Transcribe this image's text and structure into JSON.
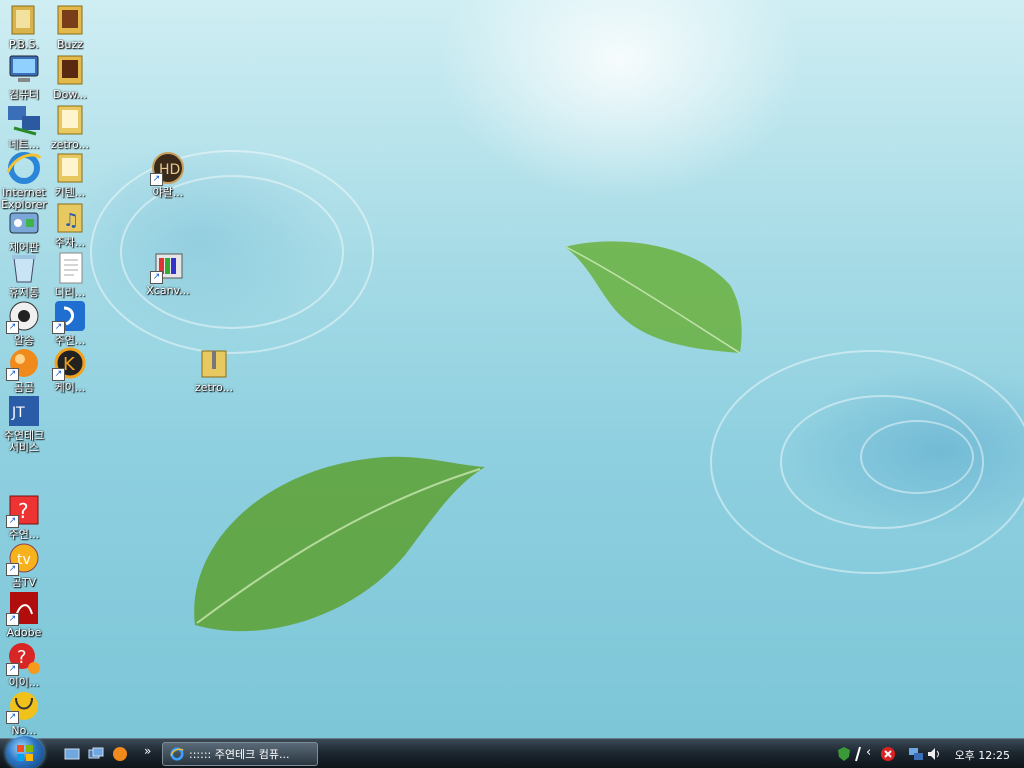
{
  "desktop": {
    "icons": [
      {
        "label": "P.B.S."
      },
      {
        "label": "Buzz"
      },
      {
        "label": "컴퓨터"
      },
      {
        "label": "Dow..."
      },
      {
        "label": "네트..."
      },
      {
        "label": "zetro..."
      },
      {
        "label": "Internet Explorer"
      },
      {
        "label": "키텐..."
      },
      {
        "label": "제어판"
      },
      {
        "label": "주차..."
      },
      {
        "label": "휴지통"
      },
      {
        "label": "디리..."
      },
      {
        "label": "알송"
      },
      {
        "label": "주연..."
      },
      {
        "label": "곰곰"
      },
      {
        "label": "케이..."
      },
      {
        "label": "주연테크 서비스"
      },
      {
        "label": "주연..."
      },
      {
        "label": "곰TV"
      },
      {
        "label": "Adobe"
      },
      {
        "label": "이이..."
      },
      {
        "label": "No..."
      },
      {
        "label": "야랄..."
      },
      {
        "label": "Xcanv..."
      },
      {
        "label": "zetro..."
      }
    ]
  },
  "taskbar": {
    "task_label": ":::::: 주연테크 컴퓨...",
    "clock": "오후 12:25",
    "chevron": "»",
    "tray_chevron": "‹"
  },
  "colors": {
    "taskbar": "#1d2730",
    "accent": "#2b74c2"
  }
}
